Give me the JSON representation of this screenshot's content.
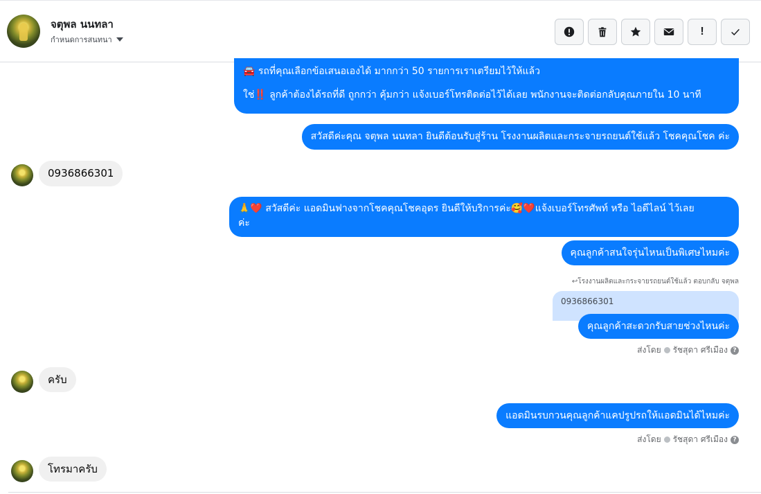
{
  "header": {
    "contact_name": "จตุพล นนทลา",
    "status_label": "กำหนดการสนทนา",
    "actions": [
      {
        "icon": "alert-circle-icon"
      },
      {
        "icon": "trash-icon"
      },
      {
        "icon": "star-icon"
      },
      {
        "icon": "envelope-icon"
      },
      {
        "icon": "exclamation-icon",
        "label": "!"
      },
      {
        "icon": "checkmark-icon"
      }
    ]
  },
  "messages": {
    "m1_line1": "🚘 รถที่คุณเลือกข้อเสนอเองได้ มากกว่า 50 รายการเราเตรียมไว้ให้แล้ว",
    "m1_line2": "ใช่‼️ ลูกค้าต้องได้รถที่ดี ถูกกว่า คุ้มกว่า แจ้งเบอร์โทรติดต่อไว้ได้เลย พนักงานจะติดต่อกลับคุณภายใน 10 นาที",
    "m2": "สวัสดีค่ะคุณ จตุพล นนทลา ยินดีต้อนรับสู่ร้าน โรงงานผลิตและกระจายรถยนต์ใช้แล้ว โชคคุณโชค ค่ะ",
    "in1": "0936866301",
    "m3_a": "🙏❤️ สวัสดีค่ะ แอดมินฟางจากโชคคุณโชคอุดร ยินดีให้บริการค่ะ🥰❤️แจ้งเบอร์โทรศัพท์ หรือ ไอดีไลน์  ไว้เลย",
    "m3_b": "ค่ะ",
    "m4": "คุณลูกค้าสนใจรุ่นไหนเป็นพิเศษไหมค่ะ",
    "reply_label": "↩︎โรงงานผลิตและกระจายรถยนต์ใช้แล้ว ตอบกลับ จตุพล",
    "quoted": "0936866301",
    "m5": "คุณลูกค้าสะดวกรับสายช่วงไหนค่ะ",
    "sent_by_prefix": "ส่งโดย",
    "sent_by_name": "รัชสุดา ศรีเมือง",
    "in2": "ครับ",
    "m6": "แอดมินรบกวนคุณลูกค้าแคปรูปรถให้แอดมินได้ไหมค่ะ",
    "in3": "โทรมาครับ"
  },
  "colors": {
    "outgoing_bubble": "#0a7cff",
    "incoming_bubble": "#f0f0f0",
    "quoted_bubble": "#cfe3ff"
  }
}
